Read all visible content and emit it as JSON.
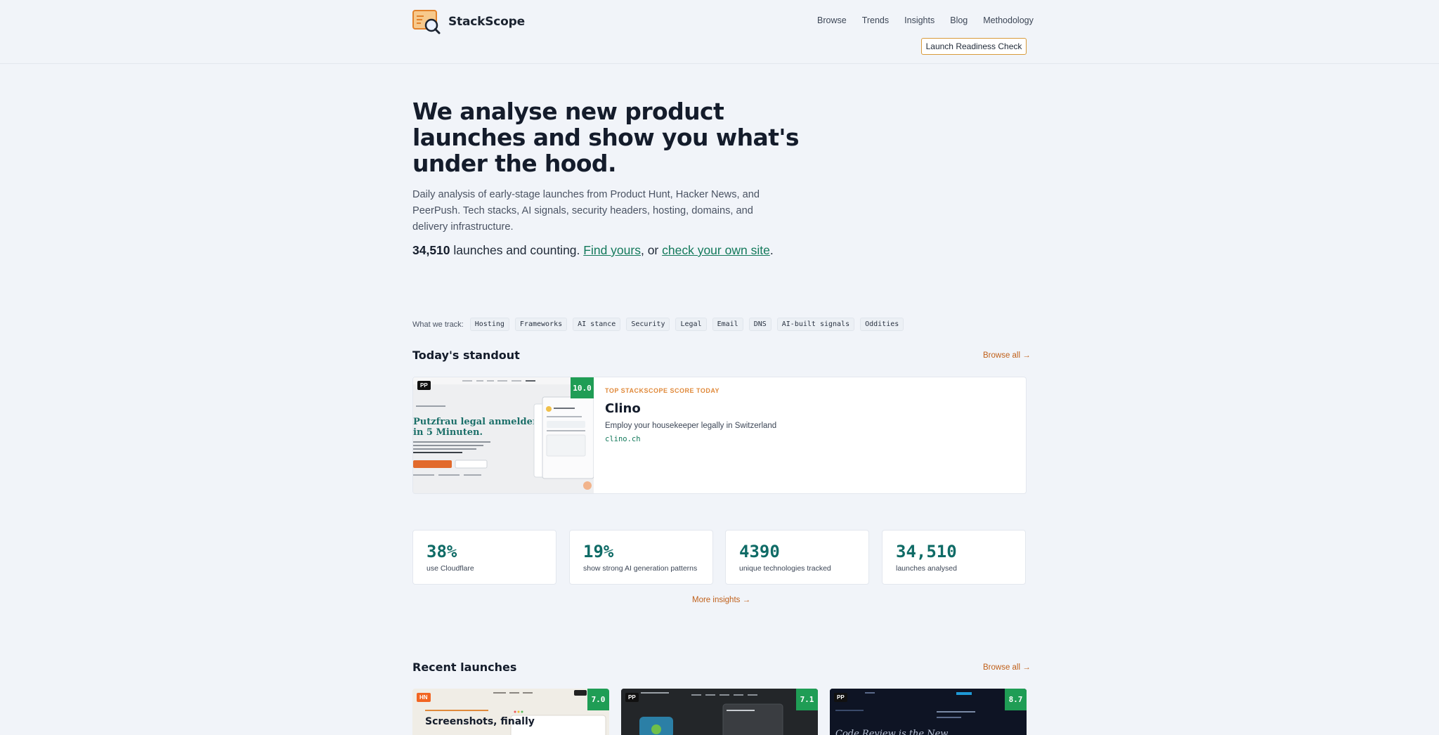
{
  "brand": {
    "name": "StackScope"
  },
  "nav": [
    "Browse",
    "Trends",
    "Insights",
    "Blog",
    "Methodology"
  ],
  "cta": "Launch Readiness Check",
  "hero": {
    "title": "We analyse new product launches and show you what's under the hood.",
    "description": "Daily analysis of early-stage launches from Product Hunt, Hacker News, and PeerPush. Tech stacks, AI signals, security headers, hosting, domains, and delivery infrastructure.",
    "count": "34,510",
    "count_text": " launches and counting. ",
    "find_link": "Find yours",
    "sep": ", or ",
    "check_link": "check your own site",
    "end": "."
  },
  "track": {
    "label": "What we track:",
    "chips": [
      "Hosting",
      "Frameworks",
      "AI stance",
      "Security",
      "Legal",
      "Email",
      "DNS",
      "AI-built signals",
      "Oddities"
    ]
  },
  "standout": {
    "heading": "Today's standout",
    "browse_all": "Browse all →",
    "eyebrow": "TOP STACKSCOPE SCORE TODAY",
    "name": "Clino",
    "tagline": "Employ your housekeeper legally in Switzerland",
    "domain": "clino.ch",
    "source": "PP",
    "score": "10.0",
    "thumb_headline_1": "Putzfrau legal anmelden",
    "thumb_headline_2": "in 5 Minuten."
  },
  "stats": [
    {
      "value": "38%",
      "label": "use Cloudflare"
    },
    {
      "value": "19%",
      "label": "show strong AI generation patterns"
    },
    {
      "value": "4390",
      "label": "unique technologies tracked"
    },
    {
      "value": "34,510",
      "label": "launches analysed"
    }
  ],
  "more_insights": "More insights →",
  "recent": {
    "heading": "Recent launches",
    "browse_all": "Browse all →",
    "cards": [
      {
        "source": "HN",
        "score": "7.0",
        "headline": "Screenshots, finally"
      },
      {
        "source": "PP",
        "score": "7.1",
        "headline": ""
      },
      {
        "source": "PP",
        "score": "8.7",
        "headline": "Code Review is the New"
      }
    ]
  },
  "colors": {
    "accent": "#13795b",
    "orange": "#c0601a",
    "score_green": "#1f9d55"
  }
}
